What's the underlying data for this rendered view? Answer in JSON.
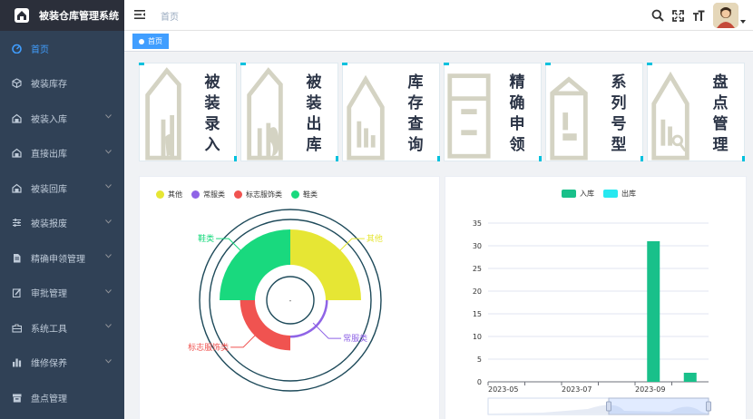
{
  "app": {
    "title": "被装仓库管理系统"
  },
  "menu": [
    {
      "label": "首页",
      "active": true,
      "icon": "dashboard-icon",
      "expand": false
    },
    {
      "label": "被装库存",
      "icon": "cube-icon",
      "expand": false
    },
    {
      "label": "被装入库",
      "icon": "warehouse-in-icon",
      "expand": true
    },
    {
      "label": "直接出库",
      "icon": "warehouse-out-icon",
      "expand": true
    },
    {
      "label": "被装回库",
      "icon": "warehouse-return-icon",
      "expand": true
    },
    {
      "label": "被装报废",
      "icon": "sliders-icon",
      "expand": true
    },
    {
      "label": "精确申领管理",
      "icon": "document-icon",
      "expand": true
    },
    {
      "label": "审批管理",
      "icon": "edit-icon",
      "expand": true
    },
    {
      "label": "系统工具",
      "icon": "toolbox-icon",
      "expand": true
    },
    {
      "label": "维修保养",
      "icon": "bar-chart-icon",
      "expand": true
    },
    {
      "label": "盘点管理",
      "icon": "archive-icon",
      "expand": false
    }
  ],
  "navbar": {
    "breadcrumb": "首页"
  },
  "tags": {
    "active": "首页"
  },
  "cards": [
    {
      "label": "被装录入",
      "icon": "house-icon"
    },
    {
      "label": "被装出库",
      "icon": "house-fire-icon"
    },
    {
      "label": "库存查询",
      "icon": "warehouse-shelf-icon"
    },
    {
      "label": "精确申领",
      "icon": "box-icon"
    },
    {
      "label": "系列号型",
      "icon": "package-icon"
    },
    {
      "label": "盘点管理",
      "icon": "house-search-icon"
    }
  ],
  "colors": {
    "sidebar": "#304156",
    "accent": "#409eff",
    "in": "#19c08a",
    "out": "#27e8f0"
  },
  "chart_data": [
    {
      "type": "pie",
      "subtype": "nightingale-rose",
      "legend": [
        "其他",
        "常服类",
        "标志服饰类",
        "鞋类"
      ],
      "legend_position": "top",
      "series": [
        {
          "name": "其他",
          "value": 31,
          "color": "#e6e634"
        },
        {
          "name": "常服类",
          "value": 2,
          "color": "#8f64e6"
        },
        {
          "name": "标志服饰类",
          "value": 13,
          "color": "#f05350"
        },
        {
          "name": "鞋类",
          "value": 31,
          "color": "#19d97e"
        }
      ]
    },
    {
      "type": "bar",
      "legend": [
        "入库",
        "出库"
      ],
      "legend_position": "top",
      "x_ticks": [
        "2023-05",
        "2023-07",
        "2023-09"
      ],
      "ylim": [
        0,
        35
      ],
      "y_ticks": [
        0,
        5,
        10,
        15,
        20,
        25,
        30,
        35
      ],
      "series": [
        {
          "name": "入库",
          "color": "#19c08a",
          "points": [
            {
              "x": "2023-09",
              "y": 31
            },
            {
              "x": "2023-10",
              "y": 2
            }
          ]
        },
        {
          "name": "出库",
          "color": "#27e8f0",
          "points": []
        }
      ]
    }
  ]
}
